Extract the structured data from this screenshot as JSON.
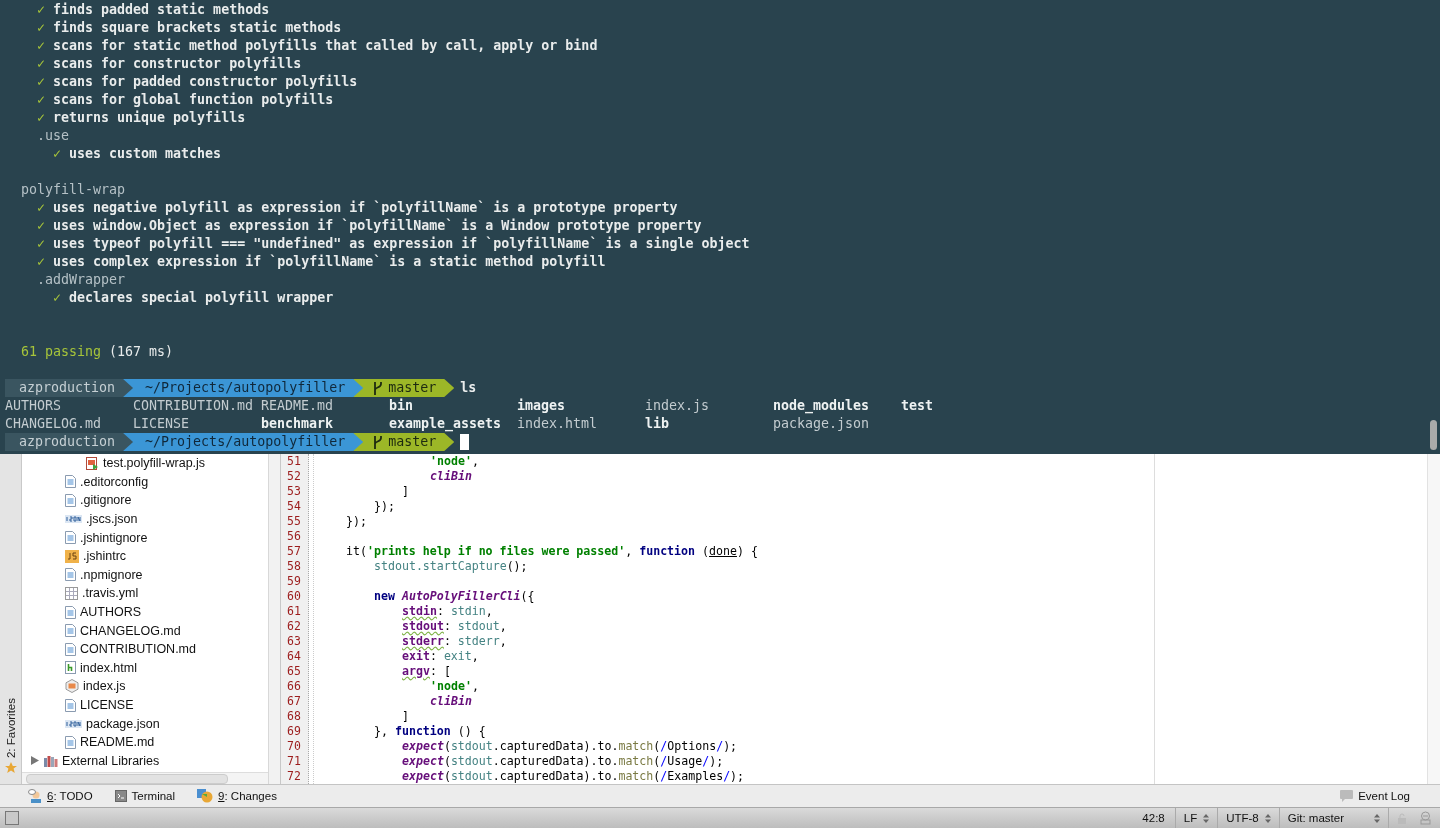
{
  "terminal": {
    "output": [
      {
        "kind": "suite",
        "children": [
          {
            "kind": "pass",
            "mark": "✓",
            "text": "finds padded static methods"
          },
          {
            "kind": "pass",
            "mark": "✓",
            "text": "finds square brackets static methods"
          },
          {
            "kind": "pass",
            "mark": "✓",
            "text": "scans for static method polyfills that called by call, apply or bind"
          },
          {
            "kind": "pass",
            "mark": "✓",
            "text": "scans for constructor polyfills"
          },
          {
            "kind": "pass",
            "mark": "✓",
            "text": "scans for padded constructor polyfills"
          },
          {
            "kind": "pass",
            "mark": "✓",
            "text": "scans for global function polyfills"
          },
          {
            "kind": "pass",
            "mark": "✓",
            "text": "returns unique polyfills"
          },
          {
            "kind": "suite",
            "title": ".use",
            "children": [
              {
                "kind": "pass",
                "mark": "✓",
                "text": "uses custom matches"
              }
            ]
          }
        ]
      },
      {
        "kind": "suite",
        "title": "polyfill-wrap",
        "children": [
          {
            "kind": "pass",
            "mark": "✓",
            "text": "uses negative polyfill as expression if `polyfillName` is a prototype property"
          },
          {
            "kind": "pass",
            "mark": "✓",
            "text": "uses window.Object as expression if `polyfillName` is a Window prototype property"
          },
          {
            "kind": "pass",
            "mark": "✓",
            "text": "uses typeof polyfill === \"undefined\" as expression if `polyfillName` is a single object"
          },
          {
            "kind": "pass",
            "mark": "✓",
            "text": "uses complex expression if `polyfillName` is a static method polyfill"
          },
          {
            "kind": "suite",
            "title": ".addWrapper",
            "children": [
              {
                "kind": "pass",
                "mark": "✓",
                "text": "declares special polyfill wrapper"
              }
            ]
          }
        ]
      }
    ],
    "summary": {
      "count": "61 passing",
      "duration": "(167 ms)"
    },
    "session": [
      {
        "kind": "prompt",
        "user": "azproduction",
        "path": "~/Projects/autopolyfiller",
        "branch": "master",
        "command": "ls",
        "cursor": false
      },
      {
        "kind": "listing",
        "rows": [
          [
            {
              "name": "AUTHORS",
              "kind": "file"
            },
            {
              "name": "CONTRIBUTION.md",
              "kind": "file"
            },
            {
              "name": "README.md",
              "kind": "file"
            },
            {
              "name": "bin",
              "kind": "dir"
            },
            {
              "name": "images",
              "kind": "dir"
            },
            {
              "name": "index.js",
              "kind": "file"
            },
            {
              "name": "node_modules",
              "kind": "dir"
            },
            {
              "name": "test",
              "kind": "dir"
            }
          ],
          [
            {
              "name": "CHANGELOG.md",
              "kind": "file"
            },
            {
              "name": "LICENSE",
              "kind": "file"
            },
            {
              "name": "benchmark",
              "kind": "dir"
            },
            {
              "name": "example_assets",
              "kind": "dir"
            },
            {
              "name": "index.html",
              "kind": "file"
            },
            {
              "name": "lib",
              "kind": "dir"
            },
            {
              "name": "package.json",
              "kind": "file"
            }
          ]
        ]
      },
      {
        "kind": "prompt",
        "user": "azproduction",
        "path": "~/Projects/autopolyfiller",
        "branch": "master",
        "cursor": true
      }
    ]
  },
  "side_strip": {
    "label": "2: Favorites"
  },
  "project_tree": [
    {
      "children": [
        {
          "children": [
            {
              "name": "test.polyfill-wrap.js",
              "kind": "js-test"
            }
          ]
        },
        {
          "name": ".editorconfig",
          "kind": "text"
        },
        {
          "name": ".gitignore",
          "kind": "text"
        },
        {
          "name": ".jscs.json",
          "kind": "json"
        },
        {
          "name": ".jshintignore",
          "kind": "text"
        },
        {
          "name": ".jshintrc",
          "kind": "js"
        },
        {
          "name": ".npmignore",
          "kind": "text"
        },
        {
          "name": ".travis.yml",
          "kind": "yml"
        },
        {
          "name": "AUTHORS",
          "kind": "text"
        },
        {
          "name": "CHANGELOG.md",
          "kind": "text"
        },
        {
          "name": "CONTRIBUTION.md",
          "kind": "text"
        },
        {
          "name": "index.html",
          "kind": "html"
        },
        {
          "name": "index.js",
          "kind": "node"
        },
        {
          "name": "LICENSE",
          "kind": "text"
        },
        {
          "name": "package.json",
          "kind": "json"
        },
        {
          "name": "README.md",
          "kind": "text"
        }
      ]
    },
    {
      "name": "External Libraries",
      "kind": "library",
      "expanded": false
    }
  ],
  "editor": {
    "lines": [
      {
        "children": [
          {
            "children": [
              {
                "children": [
                  {
                    "number": "51",
                    "tokens": [
                      {
                        "text": "'node'",
                        "kind": "str"
                      },
                      {
                        "text": ",",
                        "kind": "plain"
                      }
                    ]
                  },
                  {
                    "number": "52",
                    "tokens": [
                      {
                        "text": "cliBin",
                        "kind": "italic"
                      }
                    ]
                  }
                ]
              },
              {
                "number": "53",
                "tokens": [
                  {
                    "text": "]",
                    "kind": "plain"
                  }
                ]
              }
            ]
          },
          {
            "number": "54",
            "tokens": [
              {
                "text": "});",
                "kind": "plain"
              }
            ]
          }
        ]
      },
      {
        "number": "55",
        "tokens": [
          {
            "text": "});",
            "kind": "plain"
          }
        ]
      },
      {
        "number": "56"
      },
      {
        "number": "57",
        "tokens": [
          {
            "text": "it(",
            "kind": "plain"
          },
          {
            "text": "'prints help if no files were passed'",
            "kind": "str"
          },
          {
            "text": ", ",
            "kind": "plain"
          },
          {
            "text": "function",
            "kind": "kw"
          },
          {
            "text": " (",
            "kind": "plain"
          },
          {
            "text": "done",
            "kind": "param"
          },
          {
            "text": ") {",
            "kind": "plain"
          }
        ],
        "children": [
          {
            "number": "58",
            "tokens": [
              {
                "text": "stdout.startCapture",
                "kind": "var"
              },
              {
                "text": "();",
                "kind": "plain"
              }
            ]
          },
          {
            "number": "59"
          },
          {
            "number": "60",
            "tokens": [
              {
                "text": "new ",
                "kind": "kw"
              },
              {
                "text": "AutoPolyFillerCli",
                "kind": "italic"
              },
              {
                "text": "({",
                "kind": "plain"
              }
            ],
            "children": [
              {
                "number": "61",
                "tokens": [
                  {
                    "text": "stdin",
                    "kind": "propw"
                  },
                  {
                    "text": ": ",
                    "kind": "plain"
                  },
                  {
                    "text": "stdin",
                    "kind": "var"
                  },
                  {
                    "text": ",",
                    "kind": "plain"
                  }
                ]
              },
              {
                "number": "62",
                "tokens": [
                  {
                    "text": "stdout",
                    "kind": "propw"
                  },
                  {
                    "text": ": ",
                    "kind": "plain"
                  },
                  {
                    "text": "stdout",
                    "kind": "var"
                  },
                  {
                    "text": ",",
                    "kind": "plain"
                  }
                ]
              },
              {
                "number": "63",
                "tokens": [
                  {
                    "text": "stderr",
                    "kind": "propw"
                  },
                  {
                    "text": ": ",
                    "kind": "plain"
                  },
                  {
                    "text": "stderr",
                    "kind": "var"
                  },
                  {
                    "text": ",",
                    "kind": "plain"
                  }
                ]
              },
              {
                "number": "64",
                "tokens": [
                  {
                    "text": "exit",
                    "kind": "prop"
                  },
                  {
                    "text": ": ",
                    "kind": "plain"
                  },
                  {
                    "text": "exit",
                    "kind": "var"
                  },
                  {
                    "text": ",",
                    "kind": "plain"
                  }
                ]
              },
              {
                "number": "65",
                "tokens": [
                  {
                    "text": "argv",
                    "kind": "propw"
                  },
                  {
                    "text": ": [",
                    "kind": "plain"
                  }
                ],
                "children": [
                  {
                    "number": "66",
                    "tokens": [
                      {
                        "text": "'node'",
                        "kind": "str"
                      },
                      {
                        "text": ",",
                        "kind": "plain"
                      }
                    ]
                  },
                  {
                    "number": "67",
                    "tokens": [
                      {
                        "text": "cliBin",
                        "kind": "italic"
                      }
                    ]
                  }
                ]
              },
              {
                "number": "68",
                "tokens": [
                  {
                    "text": "]",
                    "kind": "plain"
                  }
                ]
              }
            ]
          },
          {
            "number": "69",
            "tokens": [
              {
                "text": "}, ",
                "kind": "plain"
              },
              {
                "text": "function",
                "kind": "kw"
              },
              {
                "text": " () {",
                "kind": "plain"
              }
            ],
            "children": [
              {
                "number": "70",
                "tokens": [
                  {
                    "text": "expect",
                    "kind": "italic"
                  },
                  {
                    "text": "(",
                    "kind": "plain"
                  },
                  {
                    "text": "stdout",
                    "kind": "var"
                  },
                  {
                    "text": ".capturedData).to.",
                    "kind": "plain"
                  },
                  {
                    "text": "match",
                    "kind": "method"
                  },
                  {
                    "text": "(",
                    "kind": "plain"
                  },
                  {
                    "text": "/",
                    "kind": "regex"
                  },
                  {
                    "text": "Options",
                    "kind": "plain"
                  },
                  {
                    "text": "/",
                    "kind": "regex"
                  },
                  {
                    "text": ");",
                    "kind": "plain"
                  }
                ]
              },
              {
                "number": "71",
                "tokens": [
                  {
                    "text": "expect",
                    "kind": "italic"
                  },
                  {
                    "text": "(",
                    "kind": "plain"
                  },
                  {
                    "text": "stdout",
                    "kind": "var"
                  },
                  {
                    "text": ".capturedData).to.",
                    "kind": "plain"
                  },
                  {
                    "text": "match",
                    "kind": "method"
                  },
                  {
                    "text": "(",
                    "kind": "plain"
                  },
                  {
                    "text": "/",
                    "kind": "regex"
                  },
                  {
                    "text": "Usage",
                    "kind": "plain"
                  },
                  {
                    "text": "/",
                    "kind": "regex"
                  },
                  {
                    "text": ");",
                    "kind": "plain"
                  }
                ]
              },
              {
                "number": "72",
                "tokens": [
                  {
                    "text": "expect",
                    "kind": "italic"
                  },
                  {
                    "text": "(",
                    "kind": "plain"
                  },
                  {
                    "text": "stdout",
                    "kind": "var"
                  },
                  {
                    "text": ".capturedData).to.",
                    "kind": "plain"
                  },
                  {
                    "text": "match",
                    "kind": "method"
                  },
                  {
                    "text": "(",
                    "kind": "plain"
                  },
                  {
                    "text": "/",
                    "kind": "regex"
                  },
                  {
                    "text": "Examples",
                    "kind": "plain"
                  },
                  {
                    "text": "/",
                    "kind": "regex"
                  },
                  {
                    "text": ");",
                    "kind": "plain"
                  }
                ]
              }
            ]
          }
        ]
      }
    ]
  },
  "tool_windows": [
    {
      "kind": "todo",
      "key": "6",
      "label": ": TODO"
    },
    {
      "kind": "terminal",
      "label": "Terminal"
    },
    {
      "kind": "changes",
      "key": "9",
      "label": ": Changes"
    }
  ],
  "event_log": {
    "label": "Event Log"
  },
  "status_bar": {
    "position": "42:8",
    "line_separator": "LF",
    "encoding": "UTF-8",
    "vcs": "Git: master"
  }
}
